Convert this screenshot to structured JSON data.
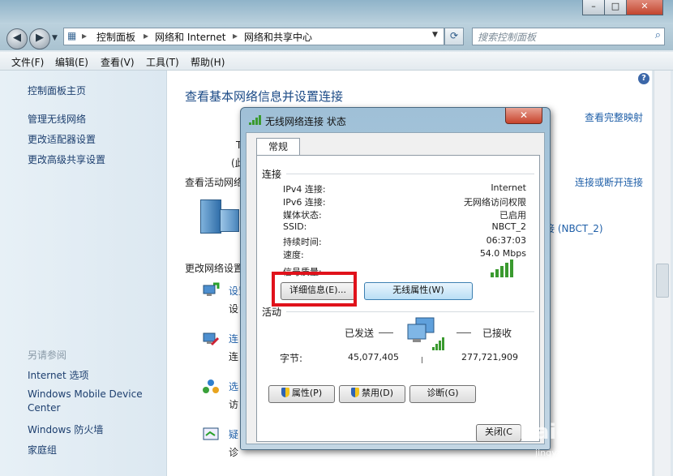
{
  "window": {
    "buttons": {
      "min": "–",
      "max": "□",
      "close": "✕"
    }
  },
  "address": {
    "segments": [
      "控制面板",
      "网络和 Internet",
      "网络和共享中心"
    ],
    "search_placeholder": "搜索控制面板"
  },
  "menubar": [
    "文件(F)",
    "编辑(E)",
    "查看(V)",
    "工具(T)",
    "帮助(H)"
  ],
  "sidebar": {
    "links": [
      "控制面板主页",
      "管理无线网络",
      "更改适配器设置",
      "更改高级共享设置"
    ],
    "see_also_header": "另请参阅",
    "see_also": [
      "Internet 选项",
      "Windows Mobile Device",
      "Center",
      "Windows 防火墙",
      "家庭组"
    ]
  },
  "main": {
    "title": "查看基本网络信息并设置连接",
    "full_map_link": "查看完整映射",
    "active_networks": "查看活动网络",
    "connect_link": "连接或断开连接",
    "network_name_link": "接 (NBCT_2)",
    "change_settings": "更改网络设置",
    "fragments": [
      "T",
      "(此",
      "设置",
      "设",
      "连",
      "连",
      "选",
      "访",
      "疑",
      "诊"
    ]
  },
  "dialog": {
    "title": "无线网络连接 状态",
    "close": "✕",
    "tab": "常规",
    "connection_header": "连接",
    "rows": [
      {
        "label": "IPv4 连接:",
        "value": "Internet"
      },
      {
        "label": "IPv6 连接:",
        "value": "无网络访问权限"
      },
      {
        "label": "媒体状态:",
        "value": "已启用"
      },
      {
        "label": "SSID:",
        "value": "NBCT_2"
      },
      {
        "label": "持续时间:",
        "value": "06:37:03"
      },
      {
        "label": "速度:",
        "value": "54.0 Mbps"
      },
      {
        "label": "信号质量:",
        "value": ""
      }
    ],
    "details_button": "详细信息(E)...",
    "wireless_props_button": "无线属性(W)",
    "activity_header": "活动",
    "sent_label": "已发送",
    "received_label": "已接收",
    "bytes_label": "字节:",
    "bytes_sent": "45,077,405",
    "bytes_received": "277,721,909",
    "properties_button": "属性(P)",
    "disable_button": "禁用(D)",
    "diagnose_button": "诊断(G)",
    "close_button": "关闭(C"
  },
  "watermark": {
    "main": "Baidu 经验",
    "sub": "jingyan.baidu.com"
  },
  "colors": {
    "highlight_box": "#e0121b",
    "link": "#1f5fa8",
    "signal": "#3a9a2f"
  }
}
